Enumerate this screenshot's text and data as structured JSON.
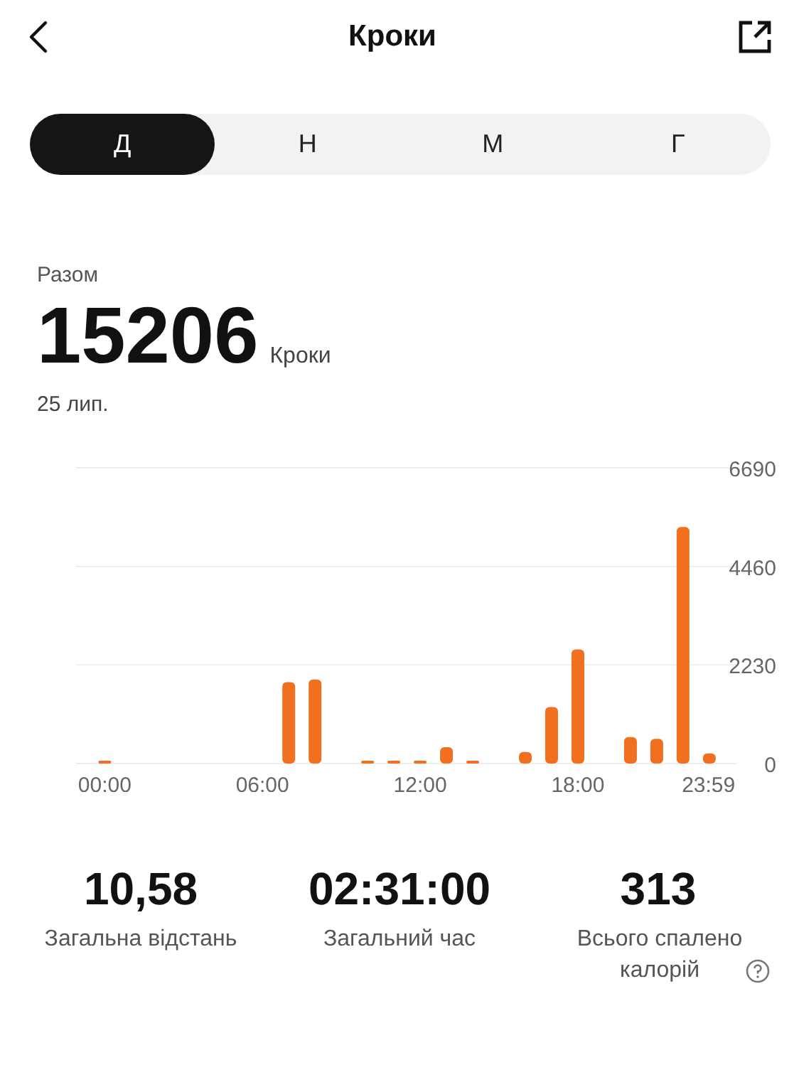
{
  "header": {
    "title": "Кроки"
  },
  "tabs": [
    {
      "label": "Д",
      "selected": true
    },
    {
      "label": "Н",
      "selected": false
    },
    {
      "label": "М",
      "selected": false
    },
    {
      "label": "Г",
      "selected": false
    }
  ],
  "summary": {
    "caption": "Разом",
    "value": "15206",
    "unit": "Кроки",
    "date": "25 лип."
  },
  "chart_data": {
    "type": "bar",
    "x": [
      0,
      7,
      8,
      10,
      11,
      12,
      13,
      14,
      16,
      17,
      18,
      20,
      21,
      22,
      23
    ],
    "series": [
      {
        "color": "#f07020",
        "values": [
          50,
          1840,
          1900,
          50,
          50,
          50,
          370,
          50,
          260,
          1280,
          2580,
          600,
          560,
          5350,
          230
        ]
      }
    ],
    "xlim": [
      -1.1,
      24.05
    ],
    "ylim": [
      0,
      6690
    ],
    "yticks": [
      0,
      2230,
      4460,
      6690
    ],
    "xticks": [
      {
        "value": 0,
        "label": "00:00"
      },
      {
        "value": 6,
        "label": "06:00"
      },
      {
        "value": 12,
        "label": "12:00"
      },
      {
        "value": 18,
        "label": "18:00"
      },
      {
        "value": 23.98,
        "label": "23:59"
      }
    ]
  },
  "stats": [
    {
      "value": "10,58",
      "label": "Загальна відстань",
      "help": false
    },
    {
      "value": "02:31:00",
      "label": "Загальний час",
      "help": false
    },
    {
      "value": "313",
      "label": "Всього спалено калорій",
      "help": true
    }
  ]
}
